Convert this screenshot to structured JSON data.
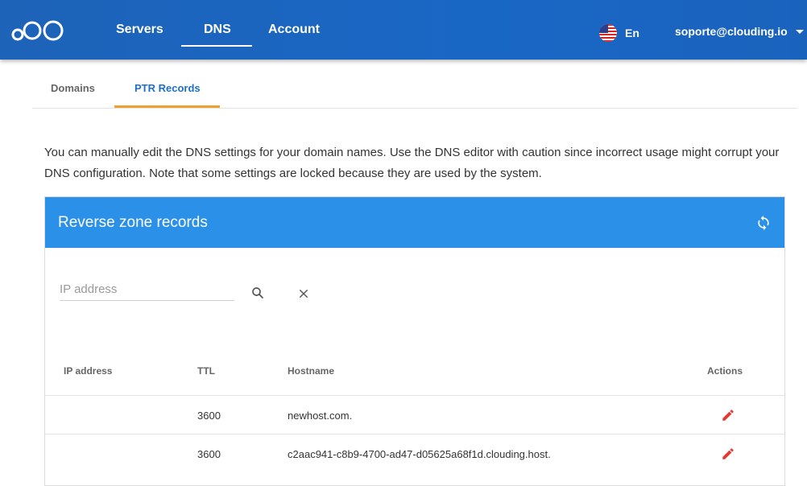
{
  "header": {
    "nav": [
      {
        "label": "Servers"
      },
      {
        "label": "DNS"
      },
      {
        "label": "Account"
      }
    ],
    "language": "En",
    "user_email": "soporte@clouding.io",
    "icons": {
      "logo": "clouding-logo",
      "flag": "us-flag-icon",
      "menu": "caret-down-icon"
    },
    "brand_color": "#1a63bd"
  },
  "tabs": [
    {
      "label": "Domains",
      "active": false
    },
    {
      "label": "PTR Records",
      "active": true
    }
  ],
  "intro_text": "You can manually edit the DNS settings for your domain names. Use the DNS editor with caution since incorrect usage might corrupt your DNS configuration. Note that some settings are locked because they are used by the system.",
  "card": {
    "title": "Reverse zone records",
    "header_color": "#2a90e8",
    "search": {
      "placeholder": "IP address",
      "value": ""
    },
    "columns": [
      "IP address",
      "TTL",
      "Hostname",
      "Actions"
    ],
    "rows": [
      {
        "ip": "",
        "ttl": "3600",
        "hostname": "newhost.com."
      },
      {
        "ip": "",
        "ttl": "3600",
        "hostname": "c2aac941-c8b9-4700-ad47-d05625a68f1d.clouding.host."
      }
    ],
    "icons": {
      "refresh": "refresh-icon",
      "search": "search-icon",
      "clear": "close-icon",
      "edit": "pencil-icon"
    },
    "edit_color": "#e53935"
  }
}
